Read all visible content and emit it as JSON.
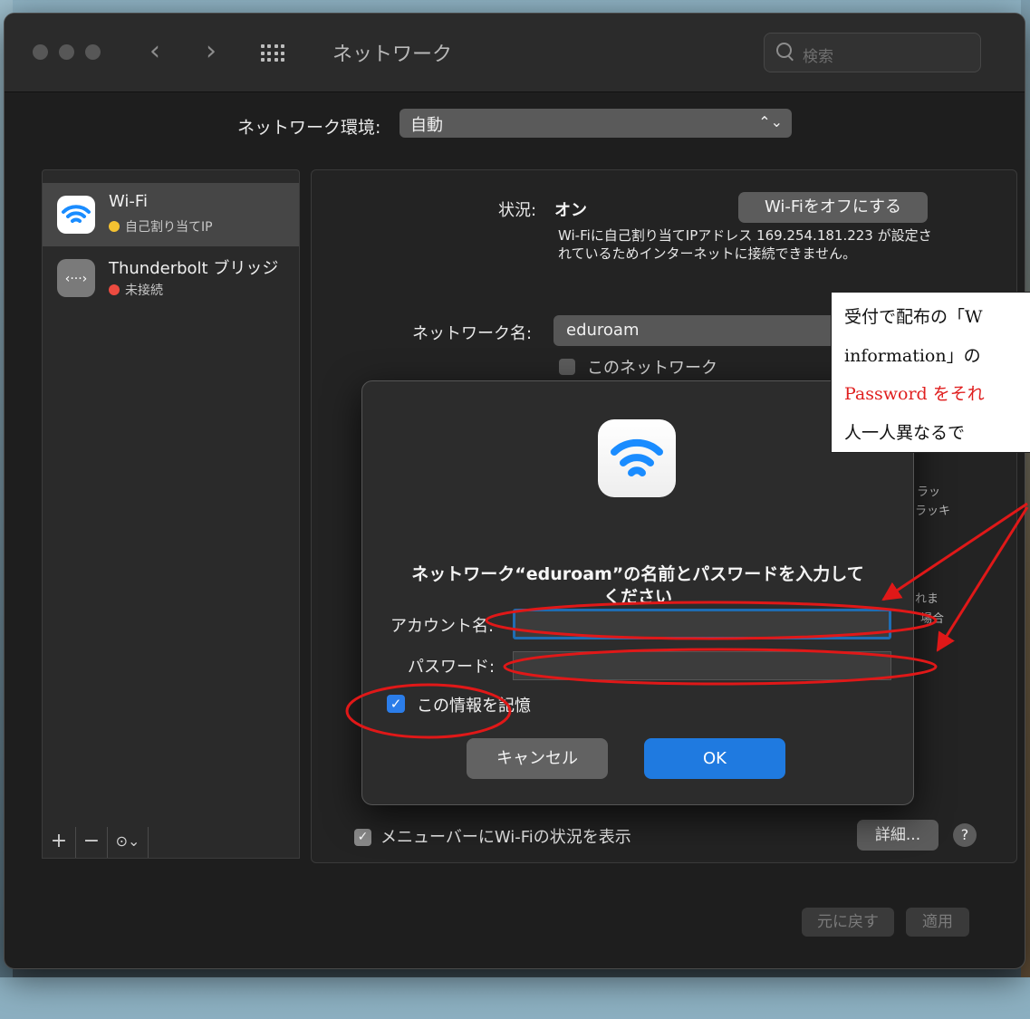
{
  "window": {
    "title": "ネットワーク",
    "search_placeholder": "検索",
    "back_glyph": "‹",
    "forward_glyph": "›"
  },
  "location": {
    "label": "ネットワーク環境:",
    "value": "自動"
  },
  "sidebar": {
    "items": [
      {
        "name": "Wi-Fi",
        "status": "自己割り当てIP",
        "status_color": "#f5c231",
        "icon": "wifi-icon",
        "selected": true
      },
      {
        "name": "Thunderbolt ブリッジ",
        "status": "未接続",
        "status_color": "#ec4b40",
        "icon": "thunderbolt-bridge-icon",
        "selected": false
      }
    ],
    "tools": {
      "add": "+",
      "remove": "−",
      "action": "⊙⌄"
    }
  },
  "detail": {
    "status_label": "状況:",
    "status_value": "オン",
    "wifi_off_button": "Wi-Fiをオフにする",
    "status_description": "Wi-Fiに自己割り当てIPアドレス 169.254.181.223 が設定されているためインターネットに接続できません。",
    "network_name_label": "ネットワーク名:",
    "network_name_value": "eduroam",
    "auto_join_partial": "このネットワーク",
    "side_fragments": [
      "ラッ",
      "ラッキ",
      "れま",
      "場合"
    ],
    "menubar_checkbox_label": "メニューバーにWi-Fiの状況を表示",
    "advanced_button": "詳細...",
    "help_button": "?",
    "revert_button": "元に戻す",
    "apply_button": "適用"
  },
  "dialog": {
    "title_line1": "ネットワーク“eduroam”の名前とパスワードを入力して",
    "title_line2": "ください",
    "account_label": "アカウント名:",
    "account_value": "",
    "password_label": "パスワード:",
    "password_value": "",
    "remember_label": "この情報を記憶",
    "remember_checked": true,
    "cancel_button": "キャンセル",
    "ok_button": "OK"
  },
  "annotation_note": {
    "line1": "受付で配布の「W",
    "line2": "information」の",
    "line3": "Password をそれ",
    "line4": "人一人異なるで"
  },
  "colors": {
    "accent": "#1f7ae0",
    "annotation": "#e01818",
    "window_bg": "#1e1e1e"
  }
}
